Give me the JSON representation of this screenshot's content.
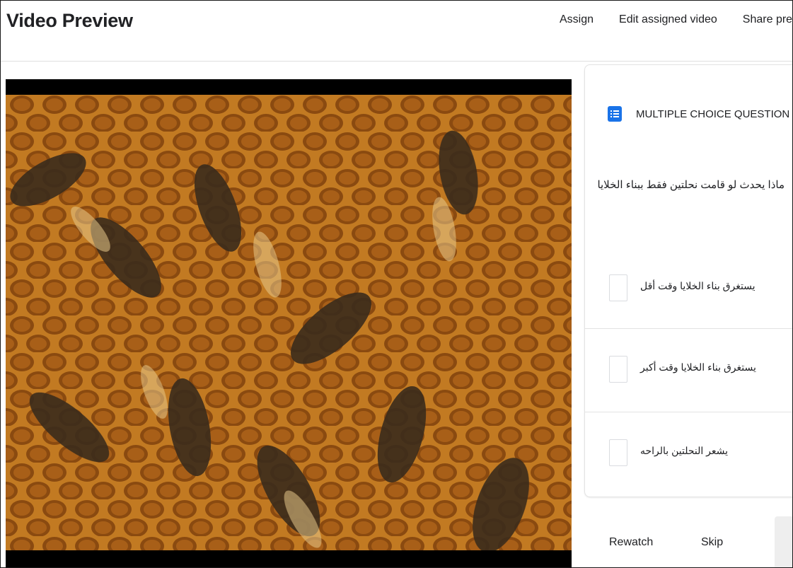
{
  "header": {
    "title": "Video Preview",
    "nav": [
      "Assign",
      "Edit assigned video",
      "Share previ"
    ]
  },
  "video": {
    "description_icon": "video-frame-icon"
  },
  "question": {
    "type_icon": "list-icon",
    "type_label": "MULTIPLE CHOICE QUESTION",
    "text": "ماذا يحدث لو قامت نحلتين فقط ببناء الخلايا",
    "options": [
      "يستغرق بناء الخلايا وقت أقل",
      "يستغرق بناء الخلايا وقت أكبر",
      "يشعر النحلتين بالراحه"
    ]
  },
  "actions": {
    "rewatch": "Rewatch",
    "skip": "Skip"
  },
  "colors": {
    "accent": "#1a73e8"
  }
}
